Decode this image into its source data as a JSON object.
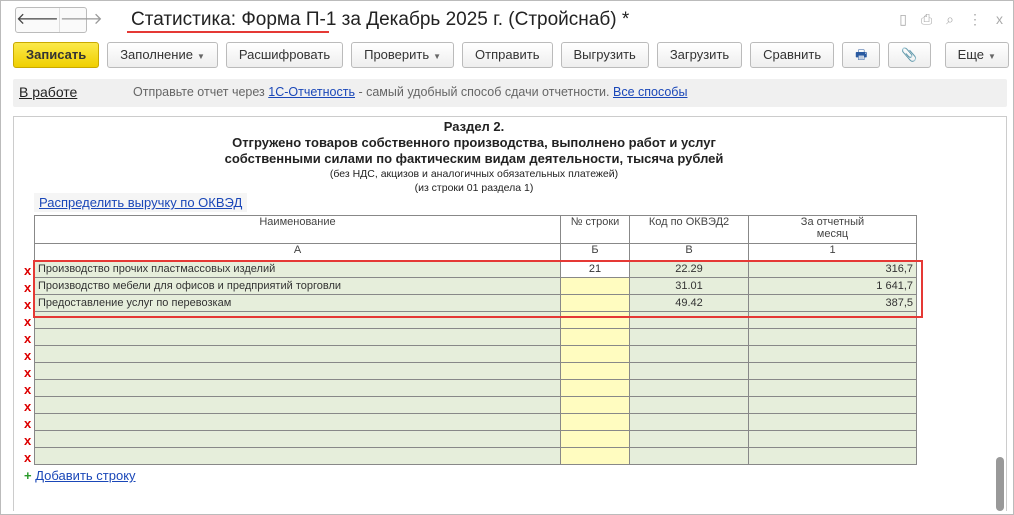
{
  "window": {
    "title": "Статистика: Форма П-1 за Декабрь 2025 г. (Стройснаб) *",
    "back": "🡐",
    "forward": "🡒",
    "icons": [
      "save-icon",
      "print-icon",
      "preview-icon",
      "more-icon",
      "close-icon"
    ],
    "close": "x",
    "more": "⋮"
  },
  "toolbar": {
    "save": "Записать",
    "fill": "Заполнение",
    "decode": "Расшифровать",
    "check": "Проверить",
    "send": "Отправить",
    "export": "Выгрузить",
    "import": "Загрузить",
    "compare": "Сравнить",
    "more": "Еще",
    "print_icon": "🖶",
    "attach_icon": "📎"
  },
  "info": {
    "status": "В работе",
    "msg_prefix": "Отправьте отчет через ",
    "msg_link": "1С-Отчетность",
    "msg_suffix": " - самый удобный способ сдачи отчетности. ",
    "all_ways": "Все способы"
  },
  "section": {
    "title": "Раздел 2.",
    "line1": "Отгружено товаров собственного производства, выполнено работ и услуг",
    "line2": "собственными силами по фактическим видам деятельности, тысяча рублей",
    "note1": "(без НДС, акцизов и аналогичных обязательных платежей)",
    "note2": "(из строки 01 раздела 1)",
    "distribute": "Распределить выручку по ОКВЭД",
    "add_row": "Добавить строку"
  },
  "table": {
    "headers": [
      "Наименование",
      "№ строки",
      "Код по ОКВЭД2",
      "За отчетный месяц"
    ],
    "letters": [
      "А",
      "Б",
      "В",
      "1"
    ],
    "rows": [
      {
        "name": "Производство прочих пластмассовых изделий",
        "line": "21",
        "code": "22.29",
        "value": "316,7"
      },
      {
        "name": "Производство мебели для офисов и предприятий торговли",
        "line": "",
        "code": "31.01",
        "value": "1 641,7"
      },
      {
        "name": "Предоставление услуг по перевозкам",
        "line": "",
        "code": "49.42",
        "value": "387,5"
      }
    ],
    "empty_rows": 9,
    "delete_mark": "x"
  },
  "colors": {
    "accent": "#f0cf00",
    "highlight": "#e53935",
    "row_bg": "#e6eedb",
    "input_bg": "#fffcc0"
  }
}
